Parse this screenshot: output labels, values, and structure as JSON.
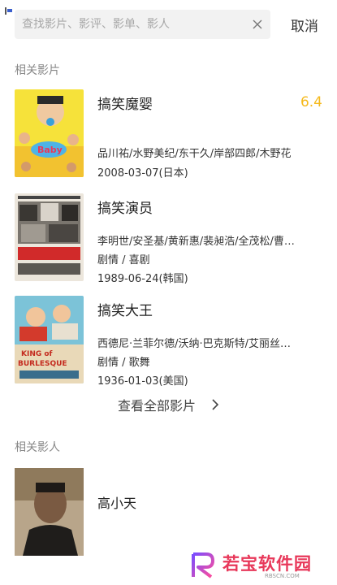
{
  "search": {
    "placeholder": "查找影片、影评、影单、影人",
    "cancel_label": "取消"
  },
  "related_movies": {
    "section_title": "相关影片",
    "items": [
      {
        "title": "搞笑魔婴",
        "rating": "6.4",
        "lines": [
          "品川祐/水野美纪/东干久/岸部四郎/木野花",
          "2008-03-07(日本)"
        ]
      },
      {
        "title": "搞笑演员",
        "rating": "",
        "lines": [
          "李明世/安圣基/黄新惠/裴昶浩/全茂松/曹…",
          "剧情  /  喜剧",
          "1989-06-24(韩国)"
        ]
      },
      {
        "title": "搞笑大王",
        "rating": "",
        "lines": [
          "西德尼·兰菲尔德/沃纳·巴克斯特/艾丽丝…",
          "剧情  /  歌舞",
          "1936-01-03(美国)"
        ]
      }
    ],
    "view_all_label": "查看全部影片"
  },
  "related_people": {
    "section_title": "相关影人",
    "items": [
      {
        "name": "高小天"
      }
    ]
  },
  "watermark": {
    "text": "若宝软件园",
    "subtext": "RBSCN.COM"
  },
  "colors": {
    "rating": "#f5b91c",
    "watermark": "#e8385a"
  }
}
